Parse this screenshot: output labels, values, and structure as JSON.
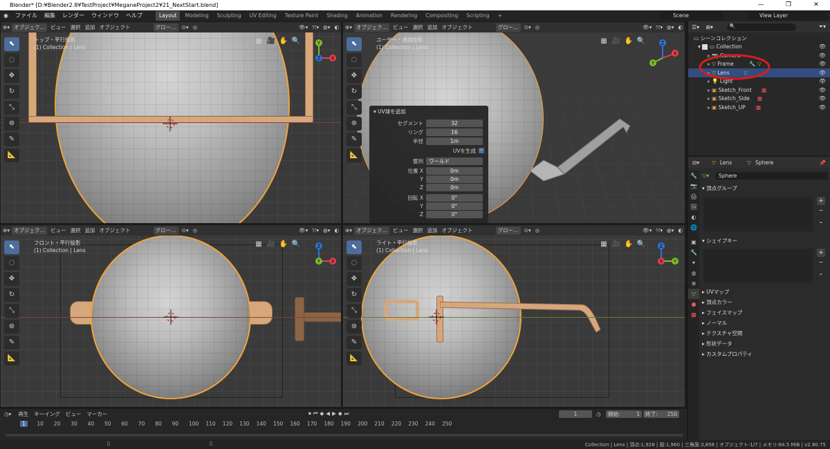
{
  "titlebar": {
    "title": "Blender* [D:¥Blender2.8¥TestProject¥MeganeProject2¥21_NextStart.blend]",
    "min": "—",
    "max": "❐",
    "close": "✕"
  },
  "menu": {
    "items": [
      "ファイル",
      "編集",
      "レンダー",
      "ウィンドウ",
      "ヘルプ"
    ],
    "workspaces": [
      "Layout",
      "Modeling",
      "Sculpting",
      "UV Editing",
      "Texture Paint",
      "Shading",
      "Animation",
      "Rendering",
      "Compositing",
      "Scripting"
    ],
    "add_tab": "+",
    "scene": "Scene",
    "view_layer": "View Layer"
  },
  "viewport_header": {
    "mode": "オブジェク…",
    "view": "ビュー",
    "select": "選択",
    "add": "追加",
    "object": "オブジェクト",
    "orientation": "グロー…"
  },
  "viewports": [
    {
      "label": "トップ・平行投影",
      "sub": "(1) Collection | Lens"
    },
    {
      "label": "ユーザー・透視投影",
      "sub": "(1) Collection | Lens"
    },
    {
      "label": "フロント・平行投影",
      "sub": "(1) Collection | Lens"
    },
    {
      "label": "ライト・平行投影",
      "sub": "(1) Collection | Lens"
    }
  ],
  "gizmo": {
    "x": "X",
    "y": "Y",
    "z": "Z"
  },
  "redo_panel": {
    "title": "UV球を追加",
    "rows": [
      {
        "label": "セグメント",
        "value": "32"
      },
      {
        "label": "リング",
        "value": "16"
      },
      {
        "label": "半径",
        "value": "1m"
      }
    ],
    "uv_label": "UVを生成",
    "align_label": "整列",
    "align_value": "ワールド",
    "loc_label": "位置 X",
    "loc": [
      "0m",
      "0m",
      "0m"
    ],
    "rot_label": "回転 X",
    "rot": [
      "0°",
      "0°",
      "0°"
    ],
    "y": "Y",
    "z": "Z"
  },
  "outliner": {
    "root": "シーンコレクション",
    "collection": "Collection",
    "items": [
      {
        "name": "Camera"
      },
      {
        "name": "Frame"
      },
      {
        "name": "Lens"
      },
      {
        "name": "Light"
      },
      {
        "name": "Sketch_Front"
      },
      {
        "name": "Sketch_Side"
      },
      {
        "name": "Sketch_UP"
      }
    ]
  },
  "properties": {
    "object": "Lens",
    "mesh": "Sphere",
    "mesh_field": "Sphere",
    "vertex_groups": "頂点グループ",
    "shape_keys": "シェイプキー",
    "sections": [
      "UVマップ",
      "頂点カラー",
      "フェイスマップ",
      "ノーマル",
      "テクスチャ空間",
      "形状データ",
      "カスタムプロパティ"
    ]
  },
  "timeline": {
    "menu": [
      "再生",
      "キーイング",
      "ビュー",
      "マーカー"
    ],
    "frame": "1",
    "start_label": "開始:",
    "start": "1",
    "end_label": "終了:",
    "end": "250",
    "ticks": [
      "1",
      "10",
      "20",
      "30",
      "40",
      "50",
      "60",
      "70",
      "80",
      "90",
      "100",
      "110",
      "120",
      "130",
      "140",
      "150",
      "160",
      "170",
      "180",
      "190",
      "200",
      "210",
      "220",
      "230",
      "240",
      "250"
    ]
  },
  "status": {
    "text": "Collection | Lens | 頂点:1,928 | 面:1,960 | 三角面:3,856 | オブジェクト:1/7 | メモリ:64.5 MiB | v2.80.75"
  },
  "colors": {
    "accent": "#4d6d9a",
    "selection": "#f2a33a",
    "frame": "#d7a77c",
    "annotation": "#d91c1c"
  }
}
